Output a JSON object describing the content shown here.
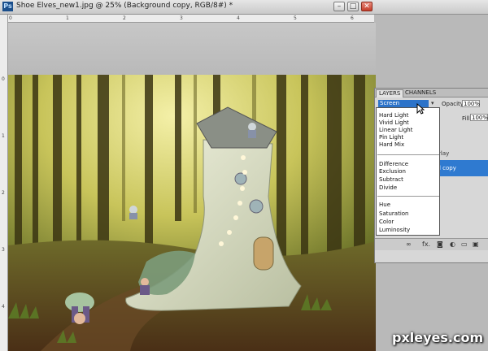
{
  "window": {
    "title": "Shoe Elves_new1.jpg @ 25% (Background copy, RGB/8#) *",
    "app_icon_text": "Ps",
    "min_glyph": "–",
    "max_glyph": "□",
    "close_glyph": "✕"
  },
  "rulers": {
    "top_labels": [
      "0",
      "1",
      "2",
      "3",
      "4",
      "5",
      "6"
    ],
    "left_labels": [
      "0",
      "1",
      "2",
      "3",
      "4"
    ]
  },
  "layers_panel": {
    "tabs": [
      "LAYERS",
      "CHANNELS"
    ],
    "blend_mode": "Screen",
    "opacity_label": "Opacity:",
    "opacity_value": "100%",
    "fill_label": "Fill:",
    "fill_value": "100%",
    "layer_partial_1": "rlay",
    "layer_partial_2": "l copy"
  },
  "blend_menu": {
    "group1": [
      "Hard Light",
      "Vivid Light",
      "Linear Light",
      "Pin Light",
      "Hard Mix"
    ],
    "group2": [
      "Difference",
      "Exclusion",
      "Subtract",
      "Divide"
    ],
    "group3": [
      "Hue",
      "Saturation",
      "Color",
      "Luminosity"
    ]
  },
  "watermark": "pxleyes.com",
  "colors": {
    "selection_blue": "#2f7ad0",
    "forest_light": "#e8e38a",
    "forest_dark": "#3b3a14"
  }
}
